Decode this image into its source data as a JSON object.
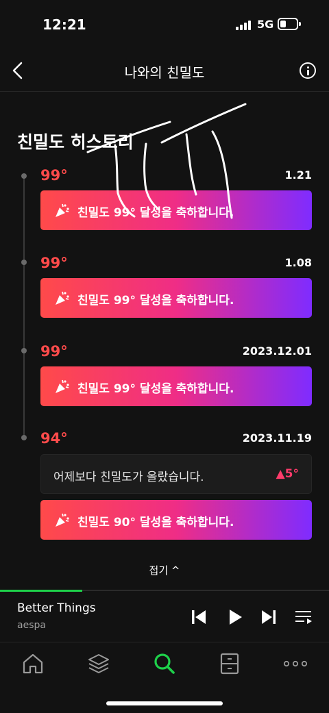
{
  "status_bar": {
    "time": "12:21",
    "network": "5G"
  },
  "nav": {
    "title": "나와의 친밀도"
  },
  "history": {
    "title": "친밀도 히스토리",
    "entries": [
      {
        "degree": "99°",
        "date": "1.21",
        "banner": "친밀도 99° 달성을 축하합니다."
      },
      {
        "degree": "99°",
        "date": "1.08",
        "banner": "친밀도 99° 달성을 축하합니다."
      },
      {
        "degree": "99°",
        "date": "2023.12.01",
        "banner": "친밀도 99° 달성을 축하합니다."
      },
      {
        "degree": "94°",
        "date": "2023.11.19",
        "message": "어제보다 친밀도가 올랐습니다.",
        "delta": "▲5°",
        "banner": "친밀도 90° 달성을 축하합니다."
      }
    ],
    "collapse_label": "접기 ^"
  },
  "player": {
    "title": "Better Things",
    "artist": "aespa",
    "progress": 0.25
  },
  "tabs": [
    "home-icon",
    "layers-icon",
    "search-icon",
    "library-icon",
    "more-icon"
  ],
  "colors": {
    "accent_green": "#1ed04a",
    "degree_red": "#ff4b4b",
    "gradient_start": "#ff4a4a",
    "gradient_end": "#7f2cff"
  }
}
